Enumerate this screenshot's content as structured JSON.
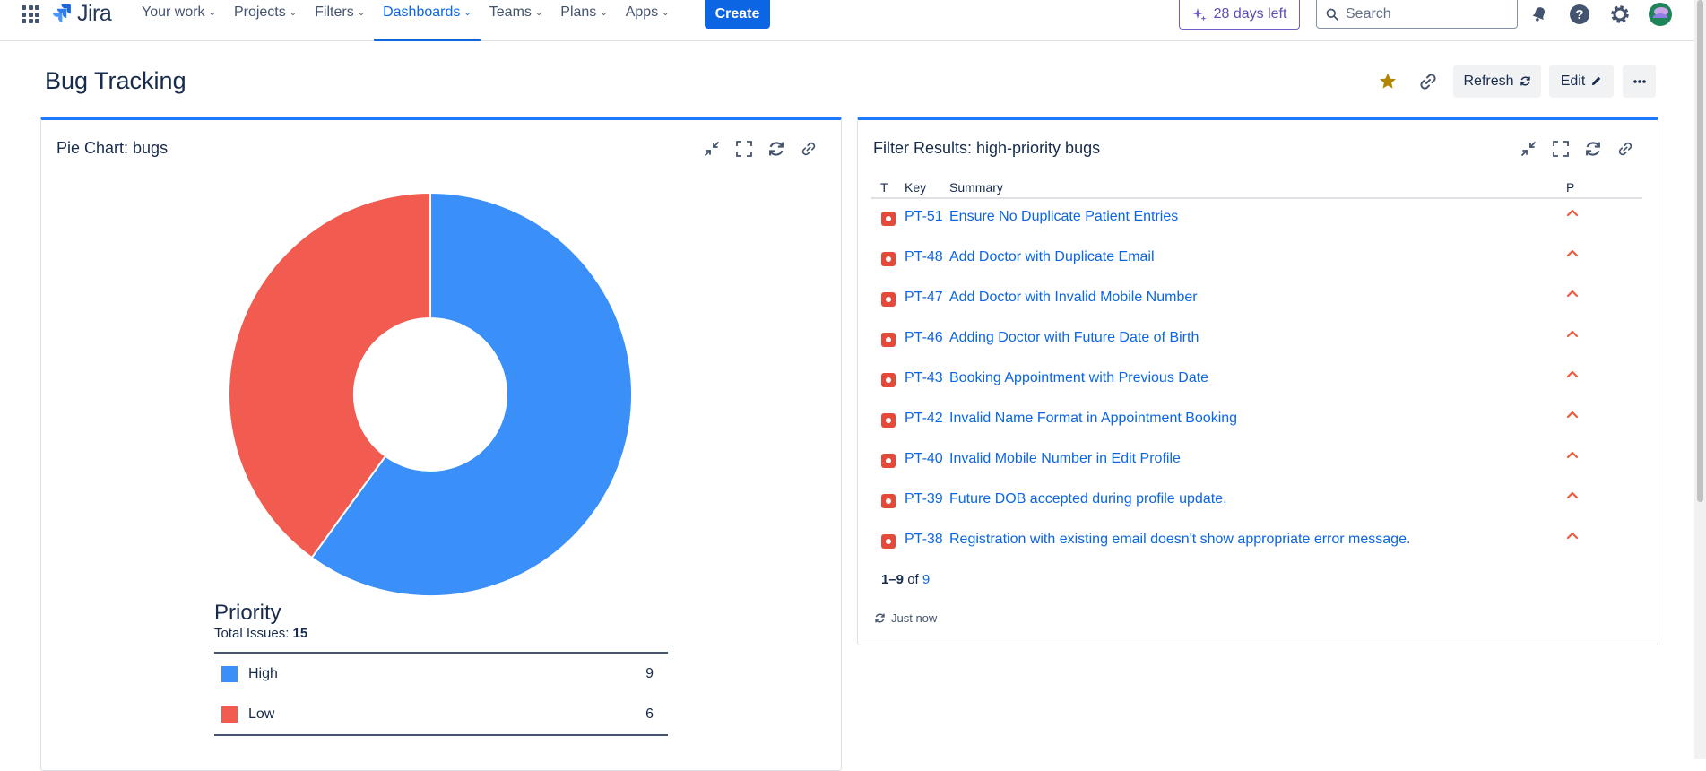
{
  "nav": {
    "logo": "Jira",
    "items": [
      {
        "label": "Your work"
      },
      {
        "label": "Projects"
      },
      {
        "label": "Filters"
      },
      {
        "label": "Dashboards"
      },
      {
        "label": "Teams"
      },
      {
        "label": "Plans"
      },
      {
        "label": "Apps"
      }
    ],
    "create_label": "Create",
    "trial_label": "28 days left",
    "search_placeholder": "Search"
  },
  "dashboard": {
    "title": "Bug Tracking",
    "refresh_label": "Refresh",
    "edit_label": "Edit"
  },
  "pie_gadget": {
    "title": "Pie Chart: bugs",
    "legend_title": "Priority",
    "total_label": "Total Issues:",
    "total_value": "15"
  },
  "chart_data": {
    "type": "pie",
    "title": "Priority",
    "categories": [
      "High",
      "Low"
    ],
    "values": [
      9,
      6
    ],
    "colors": [
      "#3b8ff9",
      "#f15b50"
    ],
    "donut": true
  },
  "filter_gadget": {
    "title": "Filter Results: high-priority bugs",
    "columns": [
      "T",
      "Key",
      "Summary",
      "P"
    ],
    "rows": [
      {
        "key": "PT-51",
        "summary": "Ensure No Duplicate Patient Entries"
      },
      {
        "key": "PT-48",
        "summary": "Add Doctor with Duplicate Email"
      },
      {
        "key": "PT-47",
        "summary": "Add Doctor with Invalid Mobile Number"
      },
      {
        "key": "PT-46",
        "summary": "Adding Doctor with Future Date of Birth"
      },
      {
        "key": "PT-43",
        "summary": "Booking Appointment with Previous Date"
      },
      {
        "key": "PT-42",
        "summary": "Invalid Name Format in Appointment Booking"
      },
      {
        "key": "PT-40",
        "summary": "Invalid Mobile Number in Edit Profile"
      },
      {
        "key": "PT-39",
        "summary": "Future DOB accepted during profile update."
      },
      {
        "key": "PT-38",
        "summary": "Registration with existing email doesn't show appropriate error message."
      }
    ],
    "pager_range": "1–9",
    "pager_of": "of",
    "pager_total": "9",
    "updated_label": "Just now"
  }
}
